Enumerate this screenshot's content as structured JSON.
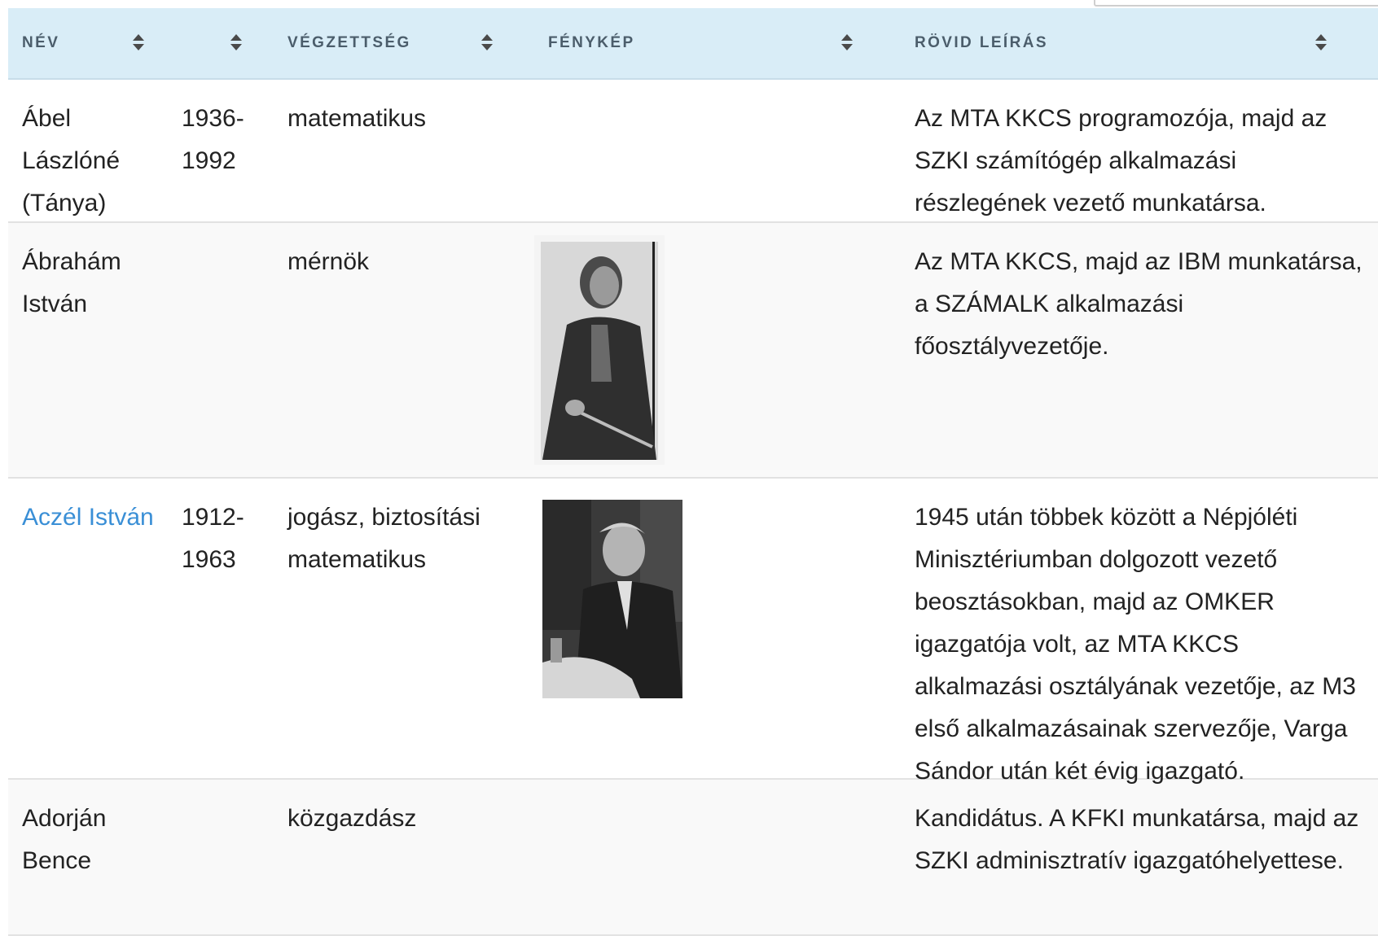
{
  "table": {
    "headers": [
      {
        "label": "NÉV"
      },
      {
        "label": ""
      },
      {
        "label": "VÉGZETTSÉG"
      },
      {
        "label": "FÉNYKÉP"
      },
      {
        "label": "RÖVID LEÍRÁS"
      }
    ],
    "rows": [
      {
        "name": "Ábel Lászlóné (Tánya)",
        "years": "1936-1992",
        "education": "matematikus",
        "photo": "",
        "description": "Az MTA KKCS programozója, majd az SZKI számítógép alkalmazási részlegének vezető munkatársa."
      },
      {
        "name": "Ábrahám István",
        "years": "",
        "education": "mérnök",
        "photo": "portrait-photo-man-working",
        "description": "Az MTA KKCS, majd az IBM munkatársa, a SZÁMALK alkalmazási főosztályvezetője."
      },
      {
        "name": "Aczél István",
        "years": "1912-1963",
        "education": "jogász, biztosítási matematikus",
        "photo": "portrait-photo-man-seated",
        "description": "1945 után többek között a Népjóléti Minisztériumban dolgozott vezető beosztásokban, majd az OMKER igazgatója volt, az MTA KKCS alkalmazási osztályának vezetője, az M3 első alkalmazásainak szervezője, Varga Sándor után két évig igazgató."
      },
      {
        "name": "Adorján Bence",
        "years": "",
        "education": "közgazdász",
        "photo": "",
        "description": "Kandidátus. A KFKI munkatársa, majd az SZKI adminisztratív igazgatóhelyettese."
      }
    ]
  },
  "colors": {
    "header_bg": "#d9edf7",
    "link": "#3a8fd6"
  }
}
